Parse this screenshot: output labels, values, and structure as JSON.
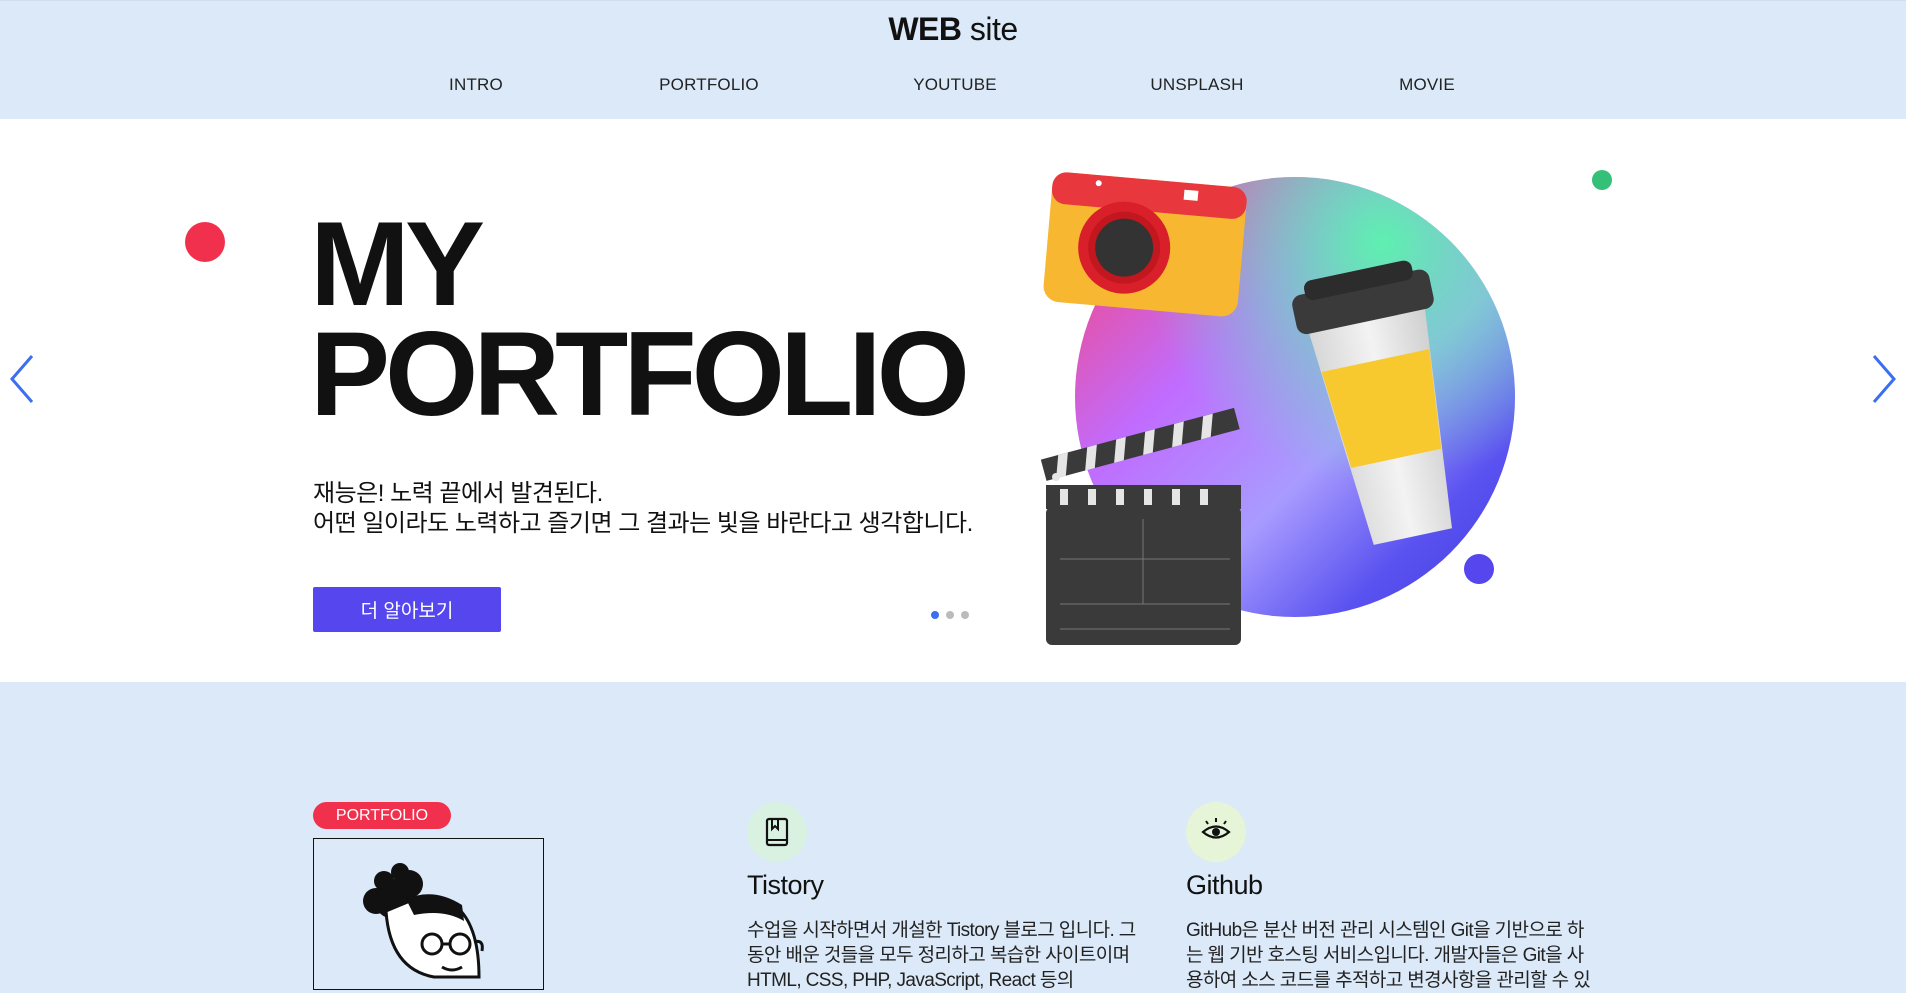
{
  "header": {
    "logo_bold": "WEB",
    "logo_light": "site",
    "nav": [
      "INTRO",
      "PORTFOLIO",
      "YOUTUBE",
      "UNSPLASH",
      "MOVIE"
    ]
  },
  "hero": {
    "title_line1": "MY",
    "title_line2": "PORTFOLIO",
    "desc_line1": "재능은! 노력 끝에서 발견된다.",
    "desc_line2": "어떤 일이라도 노력하고 즐기면 그 결과는 빛을 바란다고 생각합니다.",
    "cta_label": "더 알아보기",
    "slides": {
      "count": 3,
      "active": 1
    }
  },
  "portfolio": {
    "badge": "PORTFOLIO"
  },
  "cards": [
    {
      "icon": "bookmark-icon",
      "title": "Tistory",
      "text": "수업을 시작하면서 개설한 Tistory 블로그 입니다. 그 동안 배운 것들을 모두 정리하고 복습한 사이트이며 HTML, CSS, PHP, JavaScript, React 등의"
    },
    {
      "icon": "eye-icon",
      "title": "Github",
      "text": "GitHub은 분산 버전 관리 시스템인 Git을 기반으로 하는 웹 기반 호스팅 서비스입니다. 개발자들은 Git을 사용하여 소스 코드를 추적하고 변경사항을 관리할 수 있"
    }
  ],
  "colors": {
    "accent": "#5546ee",
    "badge": "#f1304d",
    "background": "#dbe9f9",
    "green_dot": "#35c07a"
  }
}
